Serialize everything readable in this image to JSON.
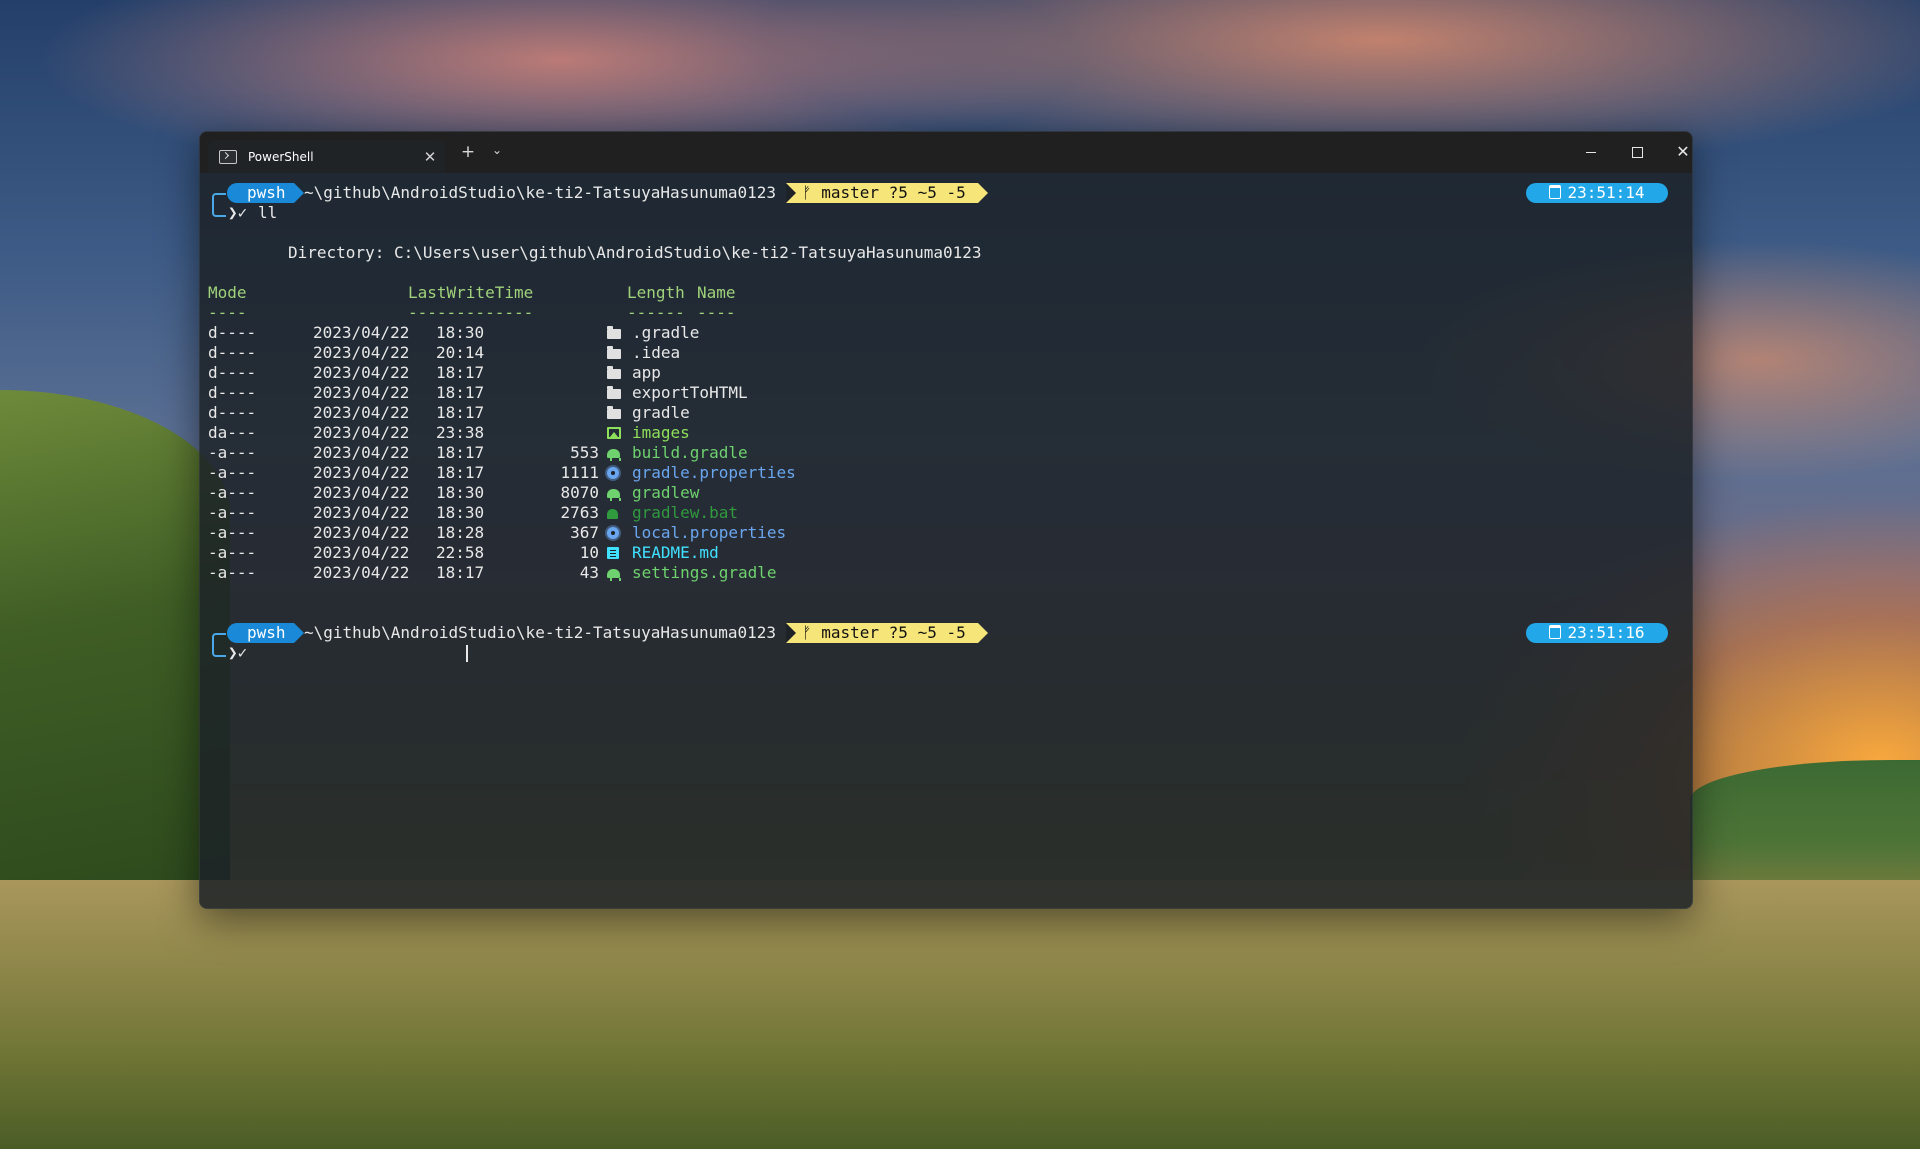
{
  "window": {
    "tab_title": "PowerShell",
    "tab_close": "✕",
    "new_tab": "+",
    "tab_dropdown": "⌄",
    "minimize": "",
    "maximize": "",
    "close": "✕"
  },
  "prompt1": {
    "shell": "pwsh",
    "path": "~\\github\\AndroidStudio\\ke-ti2-TatsuyaHasunuma0123",
    "git": "ᚠ master ?5 ~5 -5",
    "time": "23:51:14",
    "input_arrow": "❯✓",
    "command": "ll"
  },
  "listing": {
    "directory_line": "Directory: C:\\Users\\user\\github\\AndroidStudio\\ke-ti2-TatsuyaHasunuma0123",
    "headers": {
      "mode": "Mode",
      "lastwritetime": "LastWriteTime",
      "length": "Length",
      "name": "Name"
    },
    "underlines": {
      "mode": "----",
      "lastwritetime": "-------------",
      "length": "------",
      "name": "----"
    },
    "rows": [
      {
        "mode": "d----",
        "date": "2023/04/22",
        "time": "18:30",
        "length": "",
        "icon": "folder-icon",
        "name": ".gradle",
        "color": "#e8e8e8"
      },
      {
        "mode": "d----",
        "date": "2023/04/22",
        "time": "20:14",
        "length": "",
        "icon": "folder-icon",
        "name": ".idea",
        "color": "#e8e8e8"
      },
      {
        "mode": "d----",
        "date": "2023/04/22",
        "time": "18:17",
        "length": "",
        "icon": "folder-icon",
        "name": "app",
        "color": "#e8e8e8"
      },
      {
        "mode": "d----",
        "date": "2023/04/22",
        "time": "18:17",
        "length": "",
        "icon": "folder-icon",
        "name": "exportToHTML",
        "color": "#e8e8e8"
      },
      {
        "mode": "d----",
        "date": "2023/04/22",
        "time": "18:17",
        "length": "",
        "icon": "folder-icon",
        "name": "gradle",
        "color": "#e8e8e8"
      },
      {
        "mode": "da---",
        "date": "2023/04/22",
        "time": "23:38",
        "length": "",
        "icon": "image-folder-icon",
        "name": "images",
        "color": "#8ee05a"
      },
      {
        "mode": "-a---",
        "date": "2023/04/22",
        "time": "18:17",
        "length": "553",
        "icon": "gradle-elephant-icon",
        "name": "build.gradle",
        "color": "#6ed26e"
      },
      {
        "mode": "-a---",
        "date": "2023/04/22",
        "time": "18:17",
        "length": "1111",
        "icon": "gear-icon",
        "name": "gradle.properties",
        "color": "#6aa6f0"
      },
      {
        "mode": "-a---",
        "date": "2023/04/22",
        "time": "18:30",
        "length": "8070",
        "icon": "gradle-elephant-icon",
        "name": "gradlew",
        "color": "#6ed26e"
      },
      {
        "mode": "-a---",
        "date": "2023/04/22",
        "time": "18:30",
        "length": "2763",
        "icon": "batch-file-icon",
        "name": "gradlew.bat",
        "color": "#2f9a3e"
      },
      {
        "mode": "-a---",
        "date": "2023/04/22",
        "time": "18:28",
        "length": "367",
        "icon": "gear-icon",
        "name": "local.properties",
        "color": "#6aa6f0"
      },
      {
        "mode": "-a---",
        "date": "2023/04/22",
        "time": "22:58",
        "length": "10",
        "icon": "markdown-book-icon",
        "name": "README.md",
        "color": "#40e0ff"
      },
      {
        "mode": "-a---",
        "date": "2023/04/22",
        "time": "18:17",
        "length": "43",
        "icon": "gradle-elephant-icon",
        "name": "settings.gradle",
        "color": "#6ed26e"
      }
    ]
  },
  "prompt2": {
    "shell": "pwsh",
    "path": "~\\github\\AndroidStudio\\ke-ti2-TatsuyaHasunuma0123",
    "git": "ᚠ master ?5 ~5 -5",
    "time": "23:51:16",
    "input_arrow": "❯✓"
  }
}
